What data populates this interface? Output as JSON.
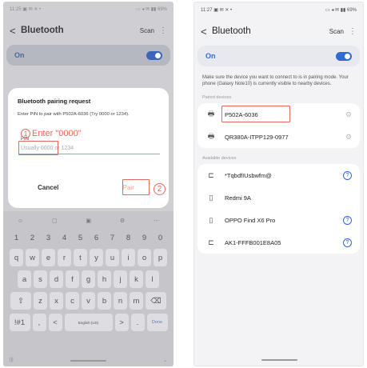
{
  "left": {
    "status": {
      "time": "11:25 ▣ ✉ ✕ •",
      "icons": "▭ ◂ ✉ ▮▮ 69%"
    },
    "header": {
      "back": "<",
      "title": "Bluetooth",
      "scan": "Scan",
      "more": "⋮"
    },
    "toggle_label": "On",
    "dialog": {
      "title": "Bluetooth pairing request",
      "message": "Enter PIN to pair with P502A-6036 (Try 0000 or 1234).",
      "pin_label": "PIN",
      "pin_placeholder": "Usually 0000 or 1234",
      "cancel": "Cancel",
      "pair": "Pair"
    },
    "annotation": {
      "step1": "1",
      "step1_text": "Enter \"0000\"",
      "step2": "2"
    },
    "keyboard": {
      "tools": [
        "☺",
        "▢",
        "▣",
        "⚙",
        "⋯"
      ],
      "numbers": [
        "1",
        "2",
        "3",
        "4",
        "5",
        "6",
        "7",
        "8",
        "9",
        "0"
      ],
      "row1": [
        "q",
        "w",
        "e",
        "r",
        "t",
        "y",
        "u",
        "i",
        "o",
        "p"
      ],
      "row2": [
        "a",
        "s",
        "d",
        "f",
        "g",
        "h",
        "j",
        "k",
        "l"
      ],
      "row3": [
        "z",
        "x",
        "c",
        "v",
        "b",
        "n",
        "m"
      ],
      "shift": "⇧",
      "backspace": "⌫",
      "sym": "!#1",
      "comma": ",",
      "left": "<",
      "space": "English (US)",
      "right": ">",
      "period": ".",
      "done": "Done",
      "bottom_left": "|||",
      "bottom_right": "⌄"
    }
  },
  "right": {
    "status": {
      "time": "11:27 ▣ ✉ ✕ •",
      "icons": "▭ ◂ ✉ ▮▮ 69%"
    },
    "header": {
      "back": "<",
      "title": "Bluetooth",
      "scan": "Scan",
      "more": "⋮"
    },
    "toggle_label": "On",
    "helptext": "Make sure the device you want to connect to is in pairing mode. Your phone (Galaxy Note10) is currently visible to nearby devices.",
    "paired_label": "Paired devices",
    "paired": [
      {
        "name": "P502A-6036",
        "icon": "printer-icon",
        "glyph": "🖶"
      },
      {
        "name": "QR380A-ITPP129-0977",
        "icon": "printer-icon",
        "glyph": "🖶"
      }
    ],
    "available_label": "Available devices",
    "available": [
      {
        "name": "*TqbdfIUsbwfm@",
        "icon": "laptop-icon",
        "glyph": "⊏",
        "help": "?"
      },
      {
        "name": "Redmi 9A",
        "icon": "phone-icon",
        "glyph": "▯",
        "help": ""
      },
      {
        "name": "OPPO Find X6 Pro",
        "icon": "phone-icon",
        "glyph": "▯",
        "help": "?"
      },
      {
        "name": "AK1-FFFB001E8A05",
        "icon": "laptop-icon",
        "glyph": "⊏",
        "help": "?"
      }
    ]
  }
}
